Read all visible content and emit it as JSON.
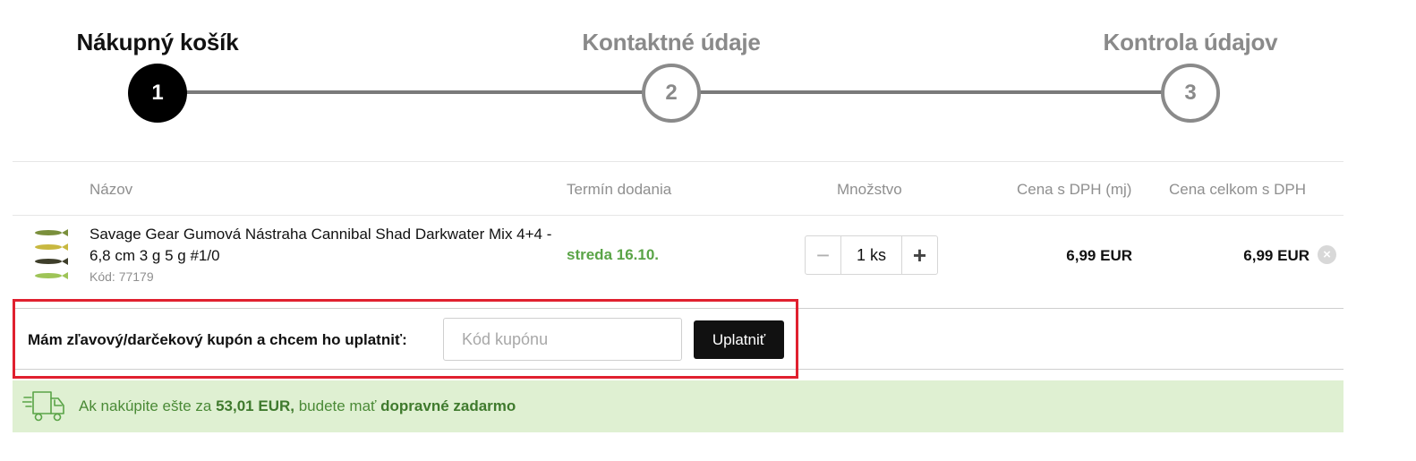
{
  "steps": [
    {
      "number": "1",
      "title": "Nákupný košík",
      "state": "active"
    },
    {
      "number": "2",
      "title": "Kontaktné údaje",
      "state": "inactive"
    },
    {
      "number": "3",
      "title": "Kontrola údajov",
      "state": "inactive"
    }
  ],
  "table": {
    "headers": {
      "name": "Názov",
      "delivery": "Termín dodania",
      "quantity": "Množstvo",
      "unit_price": "Cena s DPH (mj)",
      "total_price": "Cena celkom s DPH"
    },
    "items": [
      {
        "name": "Savage Gear Gumová Nástraha Cannibal Shad Darkwater Mix 4+4 - 6,8 cm 3 g 5 g #1/0",
        "code": "Kód: 77179",
        "delivery": "streda 16.10.",
        "quantity": "1 ks",
        "minus": "−",
        "plus": "+",
        "unit_price": "6,99 EUR",
        "total_price": "6,99 EUR",
        "remove_icon": "close-circle-icon"
      }
    ]
  },
  "coupon": {
    "label": "Mám zľavový/darčekový kupón a chcem ho uplatniť:",
    "placeholder": "Kód kupónu",
    "value": "",
    "button": "Uplatniť"
  },
  "shipping": {
    "icon": "delivery-truck-icon",
    "prefix": "Ak nakúpite ešte za ",
    "amount": "53,01 EUR,",
    "middle": " budete mať ",
    "highlight": "dopravné zadarmo"
  },
  "colors": {
    "accent_green": "#5aa447",
    "banner_bg": "#dff0d2",
    "highlight_border": "#e0202f",
    "active_step": "#000000",
    "inactive_step": "#8a8a8a"
  }
}
